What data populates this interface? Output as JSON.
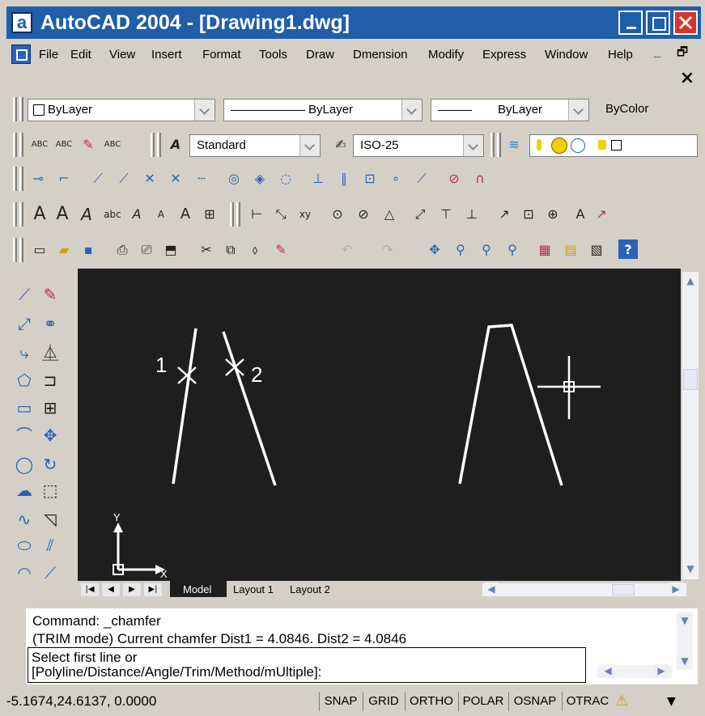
{
  "window": {
    "title": "AutoCAD 2004 - [Drawing1.dwg]",
    "app_icon_letter": "a",
    "min_label": "_",
    "restore_label": "🗗",
    "close_label": "×"
  },
  "menu": {
    "items": [
      "File",
      "Edit",
      "View",
      "Insert",
      "Format",
      "Tools",
      "Draw",
      "Dmension",
      "Modify",
      "Express",
      "Window",
      "Help"
    ],
    "doc_min": "_",
    "doc_restore": "🗗",
    "doc_close": "×"
  },
  "properties_toolbar": {
    "layer_value": "ByLayer",
    "linetype_value": "ByLayer",
    "lineweight_value": "ByLayer",
    "color_value": "ByColor"
  },
  "styles_toolbar": {
    "text_style": "Standard",
    "dim_style": "ISO-25"
  },
  "canvas": {
    "label_1": "1",
    "label_2": "2",
    "ucs_x": "X",
    "ucs_y": "Y"
  },
  "tabs": {
    "model": "Model",
    "layout1": "Layout 1",
    "layout2": "Layout 2"
  },
  "command": {
    "line1": "Command: _chamfer",
    "line2": "(TRIM mode) Current chamfer Dist1 = 4.0846.  Dist2 = 4.0846",
    "prompt1": "Select first line or",
    "prompt2": "[Polyline/Distance/Angle/Trim/Method/mUltiple]:"
  },
  "status": {
    "coords": "-5.1674,24.6137, 0.0000",
    "buttons": [
      "SNAP",
      "GRID",
      "ORTHO",
      "POLAR",
      "OSNAP",
      "OTRAC"
    ]
  },
  "colors": {
    "titlebar": "#1f5ea8",
    "close_button": "#d9342b",
    "canvas_bg": "#1e1e1e",
    "drawing_lines": "#ffffff"
  }
}
